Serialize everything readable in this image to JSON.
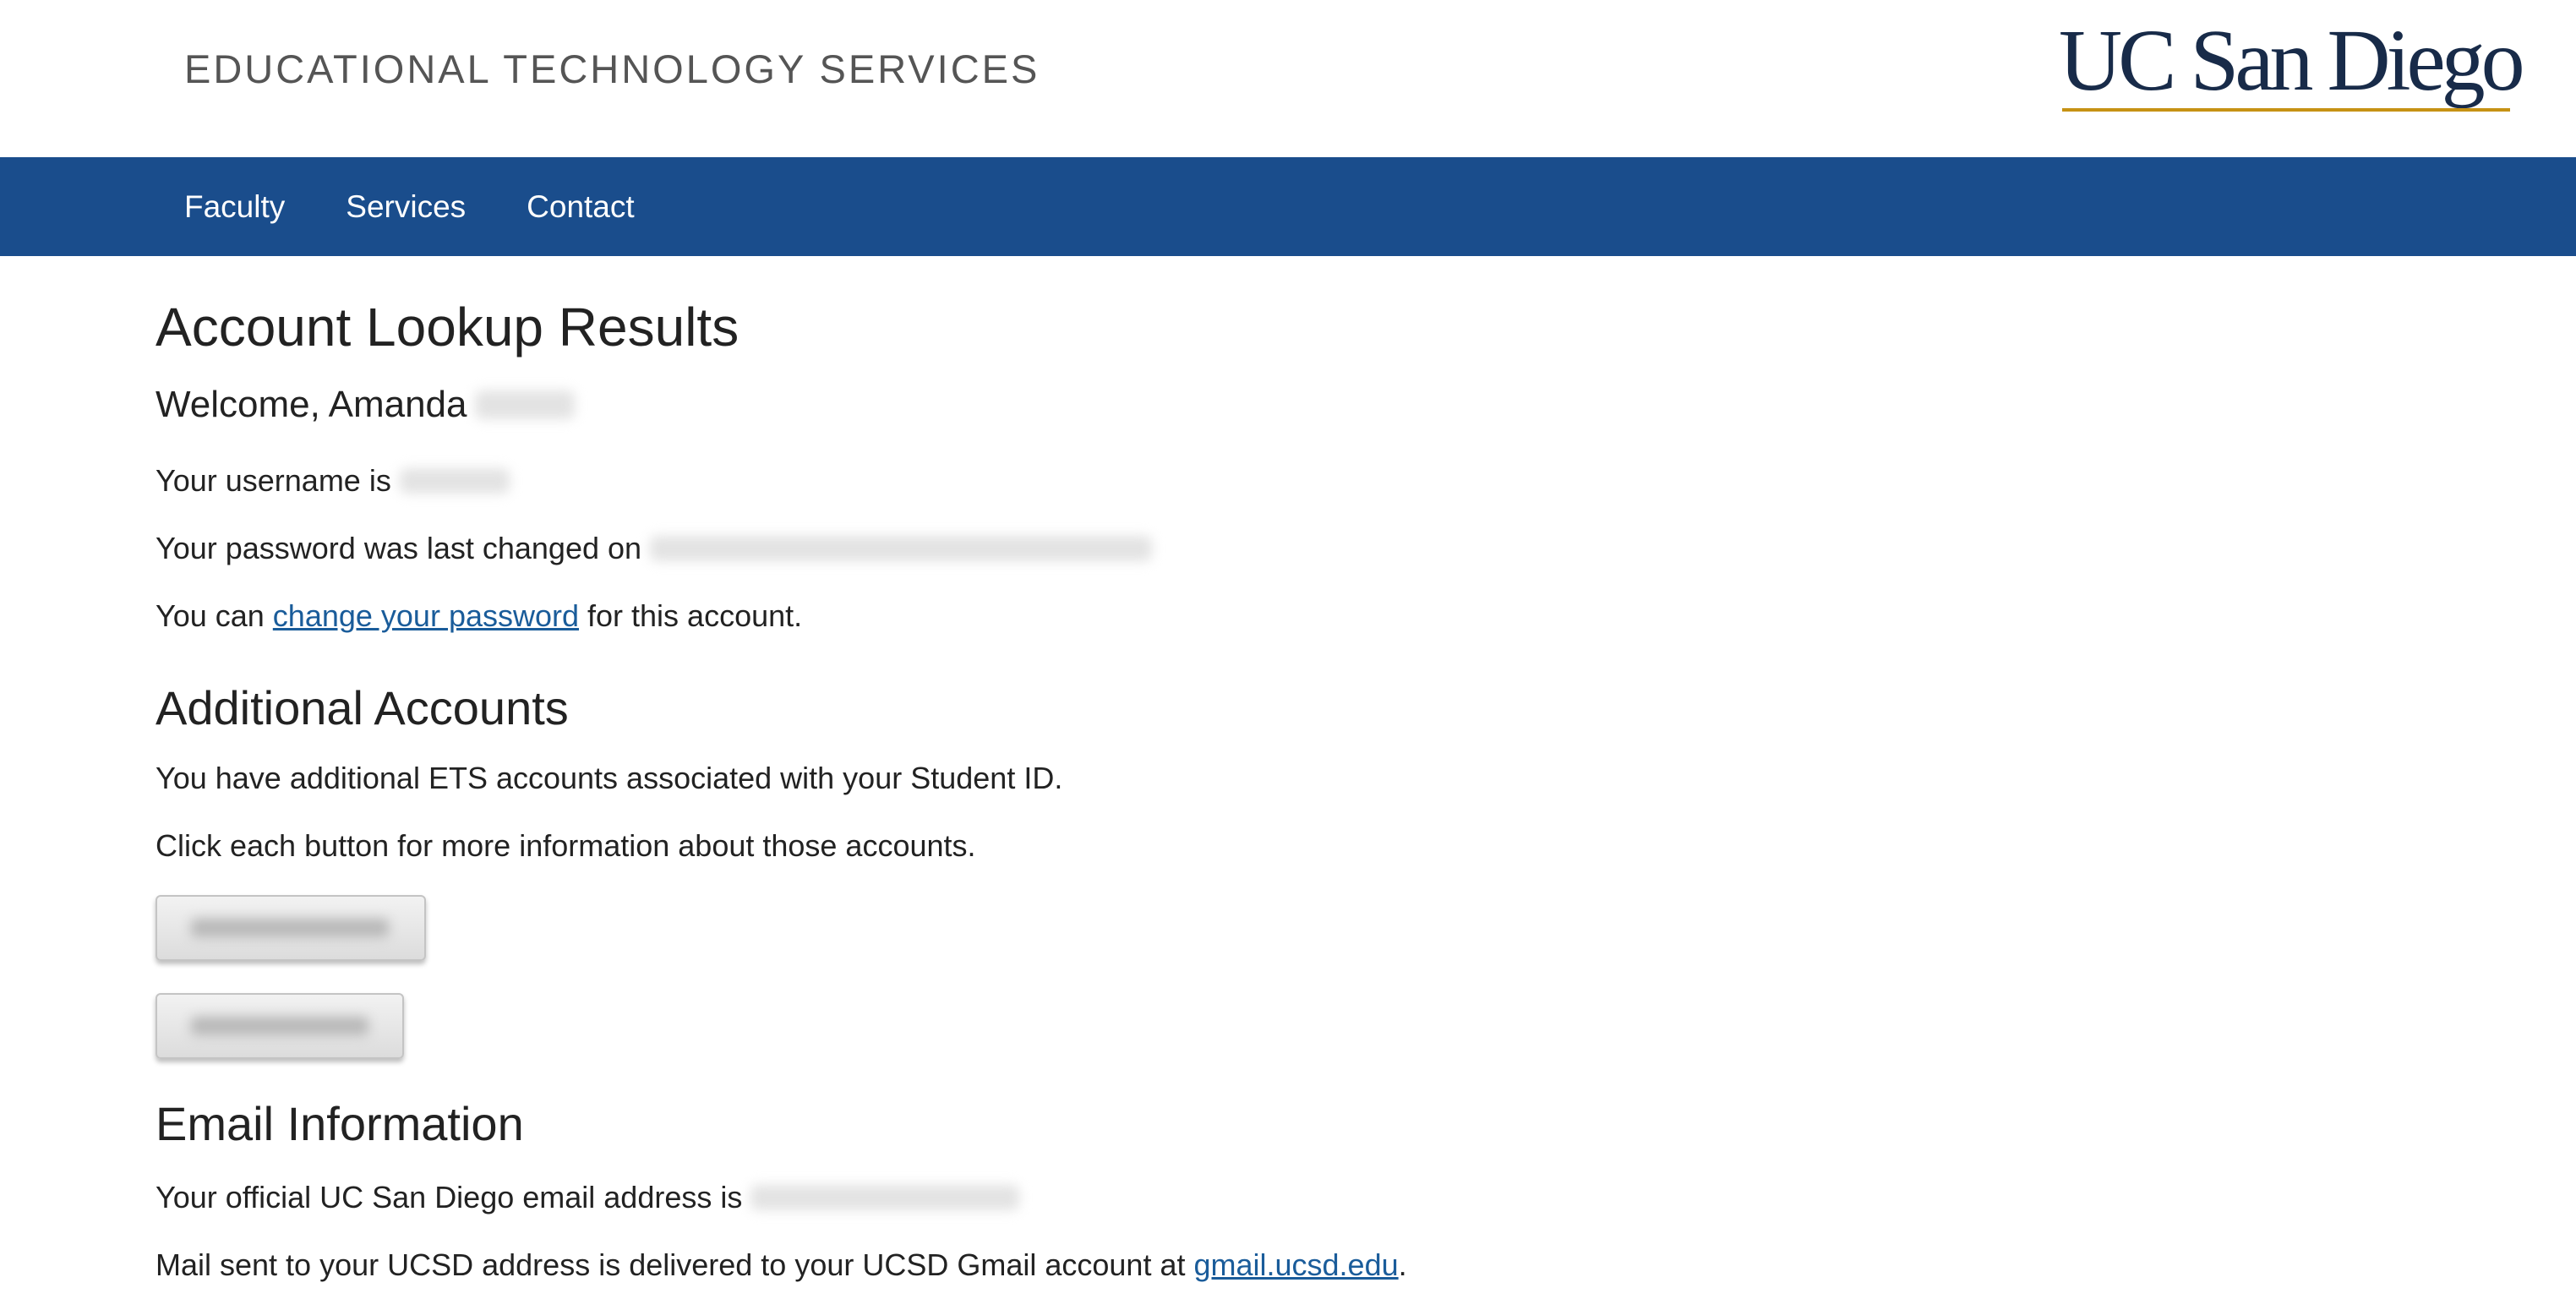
{
  "header": {
    "site_title": "EDUCATIONAL TECHNOLOGY SERVICES",
    "logo_text": "UC San Diego",
    "brand_color": "#182B49",
    "accent_color": "#C69214"
  },
  "nav": {
    "bar_color": "#1A4D8C",
    "items": [
      {
        "label": "Faculty"
      },
      {
        "label": "Services"
      },
      {
        "label": "Contact"
      }
    ]
  },
  "results": {
    "title": "Account Lookup Results",
    "welcome": "Welcome, Amanda",
    "username_prefix": "Your username is",
    "password_prefix": "Your password was last changed on",
    "change_prefix": "You can",
    "change_link": "change your password",
    "change_suffix": "for this account."
  },
  "additional": {
    "title": "Additional Accounts",
    "line1": "You have additional ETS accounts associated with your Student ID.",
    "line2": "Click each button for more information about those accounts.",
    "buttons": [
      {
        "label": ""
      },
      {
        "label": ""
      }
    ]
  },
  "email": {
    "title": "Email Information",
    "official_prefix": "Your official UC San Diego email address is",
    "mail_prefix": "Mail sent to your UCSD address is delivered to your UCSD Gmail account at",
    "gmail_link": "gmail.ucsd.edu",
    "mail_suffix": "."
  }
}
